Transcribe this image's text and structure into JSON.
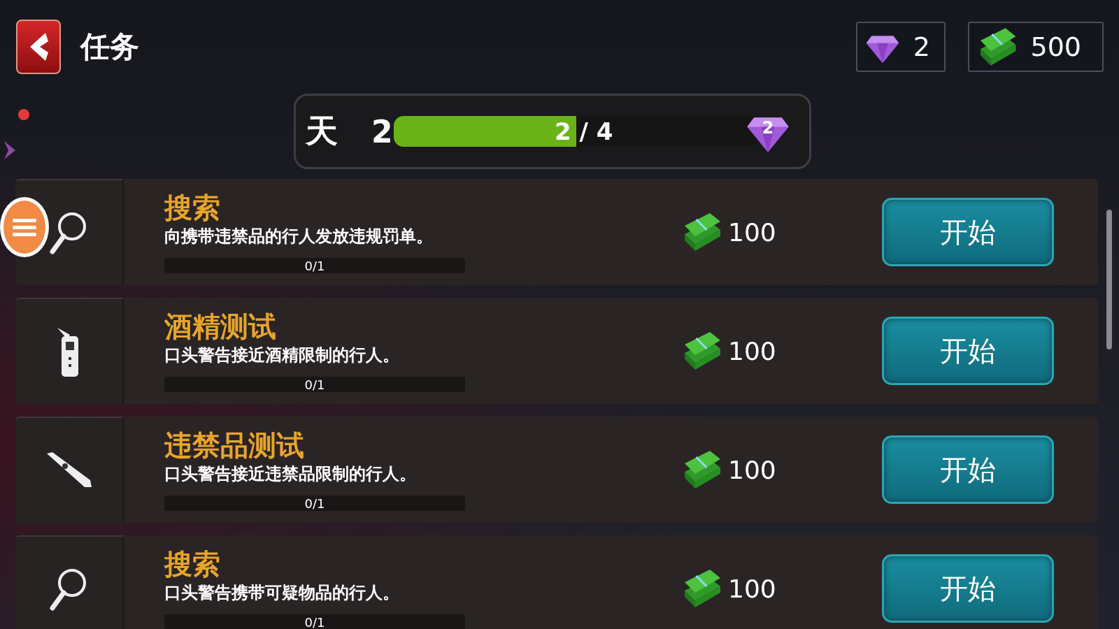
{
  "header": {
    "title": "任务",
    "gems": "2",
    "cash": "500"
  },
  "day": {
    "label": "天",
    "number": "2",
    "progress": "2 / 4",
    "level": 0.5,
    "reward": "2"
  },
  "tasks": [
    {
      "kind": "search",
      "title": "搜索",
      "description": "向携带违禁品的行人发放违规罚单。",
      "progress": "0/1",
      "level": 0,
      "reward": "100",
      "button": "开始"
    },
    {
      "kind": "breathalyzer",
      "title": "酒精测试",
      "description": "口头警告接近酒精限制的行人。",
      "progress": "0/1",
      "level": 0,
      "reward": "100",
      "button": "开始"
    },
    {
      "kind": "detector",
      "title": "违禁品测试",
      "description": "口头警告接近违禁品限制的行人。",
      "progress": "0/1",
      "level": 0,
      "reward": "100",
      "button": "开始"
    },
    {
      "kind": "search",
      "title": "搜索",
      "description": "口头警告携带可疑物品的行人。",
      "progress": "0/1",
      "level": 0,
      "reward": "100",
      "button": "开始"
    }
  ]
}
